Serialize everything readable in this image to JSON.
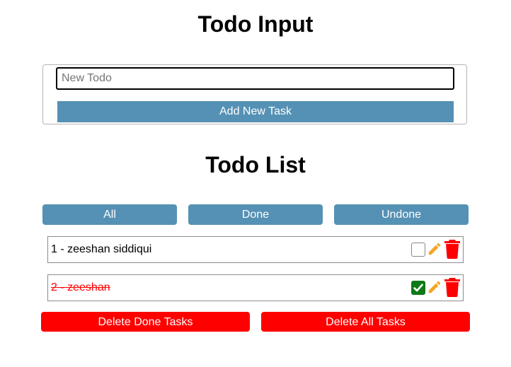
{
  "input_section": {
    "title": "Todo Input",
    "placeholder": "New Todo",
    "value": "",
    "add_button_label": "Add New Task"
  },
  "list_section": {
    "title": "Todo List",
    "filters": [
      {
        "label": "All"
      },
      {
        "label": "Done"
      },
      {
        "label": "Undone"
      }
    ],
    "tasks": [
      {
        "text": "1 - zeeshan siddiqui",
        "done": false
      },
      {
        "text": "2 - zeeshan",
        "done": true
      }
    ],
    "delete_done_label": "Delete Done Tasks",
    "delete_all_label": "Delete All Tasks"
  },
  "icons": {
    "checkbox": "checkbox-icon",
    "edit": "pencil-icon",
    "delete": "trash-icon"
  },
  "colors": {
    "primary_button": "#5591b4",
    "danger_button": "#ff0000",
    "done_text": "#ff0000",
    "checked_box": "#0d7a17",
    "edit_icon": "#f5a623",
    "trash_icon": "#ff0000"
  }
}
